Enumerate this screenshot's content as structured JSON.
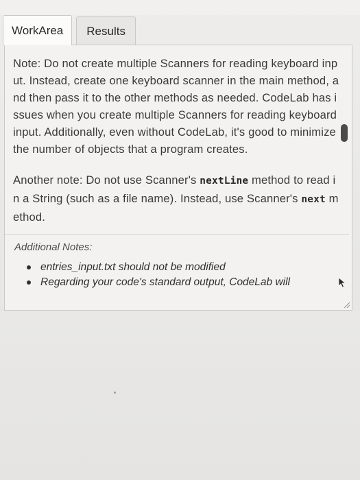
{
  "tabs": [
    {
      "label": "WorkArea",
      "active": true
    },
    {
      "label": "Results",
      "active": false
    }
  ],
  "main": {
    "para1": "Note: Do not create multiple Scanners for reading keyboard input. Instead, create one keyboard scanner in the main method, and then pass it to the other methods as needed. CodeLab has issues when you create multiple Scanners for reading keyboard input. Additionally, even without CodeLab, it's good to minimize the number of objects that a program creates.",
    "para2": {
      "part1": "Another note: Do not use Scanner's ",
      "code1": "nextLine",
      "part2": " method to read in a String (such as a file name). Instead, use Scanner's ",
      "code2": "next",
      "part3": " method."
    },
    "notes": {
      "heading": "Additional Notes:",
      "items": [
        "entries_input.txt should not be modified",
        "Regarding your code's standard output, CodeLab will"
      ]
    }
  },
  "colors": {
    "text": "#3a3a3a",
    "panel_bg": "#f3f2f0",
    "active_tab_bg": "#fbfbfa",
    "border": "#c9c8c6"
  },
  "icons": [
    "scrollbar-thumb",
    "mouse-cursor-icon",
    "resize-grip-icon"
  ]
}
